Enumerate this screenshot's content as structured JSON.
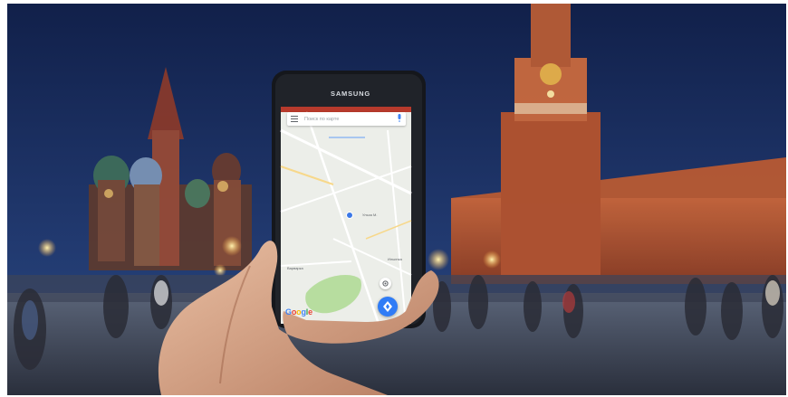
{
  "scene": {
    "description_colors": {
      "sky_top": "#12224a",
      "sky_bottom": "#24407a",
      "brick": "#b5522e",
      "map_bg": "#eef0ec",
      "park_green": "#b9dfa0",
      "accent_blue": "#2f7cf6"
    }
  },
  "phone": {
    "brand": "SAMSUNG",
    "maps_app": {
      "search_placeholder": "Поиск по карте",
      "menu_icon": "hamburger-menu-icon",
      "mic_icon": "microphone-icon",
      "street_labels": [
        "Ульха М.",
        "Варварка",
        "Ильинка"
      ],
      "logo": {
        "letters": [
          "G",
          "o",
          "o",
          "g",
          "l",
          "e"
        ],
        "colors": [
          "#4285f4",
          "#ea4335",
          "#fbbc05",
          "#4285f4",
          "#34a853",
          "#ea4335"
        ]
      },
      "locate_icon": "my-location-icon",
      "navigation_icon": "navigation-arrow-icon"
    }
  }
}
